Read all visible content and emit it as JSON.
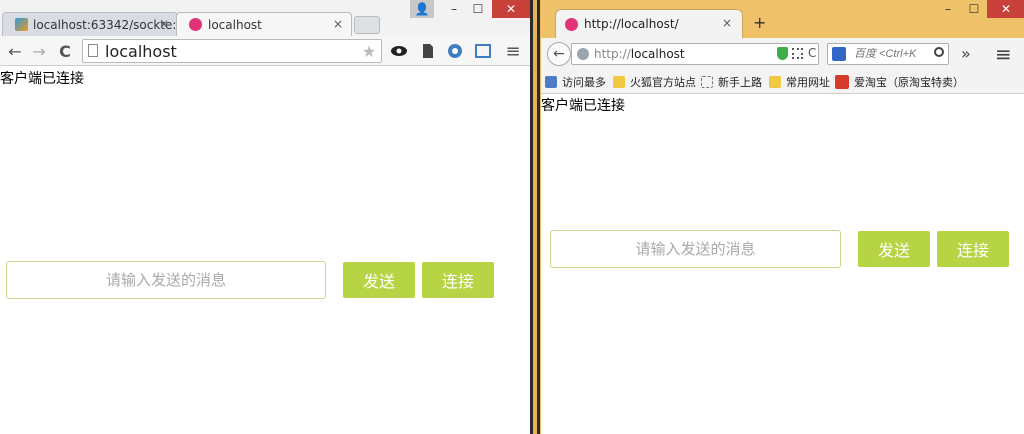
{
  "left": {
    "tabs": [
      {
        "label": "localhost:63342/sockte:",
        "close": "×"
      },
      {
        "label": "localhost",
        "close": "×"
      }
    ],
    "window_controls": {
      "user": "👤",
      "minimize": "–",
      "maximize": "☐",
      "close": "✕"
    },
    "toolbar": {
      "back": "←",
      "forward": "→",
      "reload": "C",
      "url": "localhost",
      "star": "★",
      "menu": "≡"
    },
    "status": "客户端已连接",
    "input_placeholder": "请输入发送的消息",
    "send_label": "发送",
    "connect_label": "连接"
  },
  "right": {
    "tab": {
      "label": "http://localhost/",
      "close": "×",
      "new_tab": "+"
    },
    "window_controls": {
      "minimize": "–",
      "maximize": "☐",
      "close": "✕"
    },
    "navbar": {
      "back": "←",
      "url_prefix": "http://",
      "url_host": "localhost",
      "reload": "C",
      "search_placeholder": "百度 <Ctrl+K",
      "overflow": "»",
      "menu": "≡"
    },
    "bookmarks": [
      "访问最多",
      "火狐官方站点",
      "新手上路",
      "常用网址",
      "爱淘宝（原淘宝特卖）"
    ],
    "status": "客户端已连接",
    "input_placeholder": "请输入发送的消息",
    "send_label": "发送",
    "connect_label": "连接"
  },
  "colors": {
    "button_green": "#b7d444",
    "input_border": "#c5d98a",
    "firefox_titlebar": "#efc26a"
  }
}
